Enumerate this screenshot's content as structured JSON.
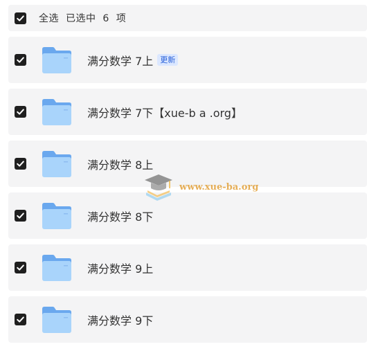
{
  "header": {
    "select_all_label": "全选",
    "selected_text": "已选中  6  项"
  },
  "icons": {
    "checkbox": "checkbox-checked-icon",
    "folder": "folder-icon",
    "watermark": "graduation-cap-book-icon"
  },
  "colors": {
    "row_background": "#f4f4f5",
    "checkbox": "#1f1f1f",
    "folder_light": "#a9d4fb",
    "folder_dark": "#6aa8ee",
    "badge_text": "#2b62d9",
    "badge_background": "#dbe7ff",
    "watermark": "#e2a13a"
  },
  "files": [
    {
      "name": "满分数学 7上",
      "badge": "更新",
      "checked": true
    },
    {
      "name": "满分数学 7下【xue-b a .org】",
      "checked": true
    },
    {
      "name": "满分数学 8上",
      "checked": true
    },
    {
      "name": "满分数学 8下",
      "checked": true
    },
    {
      "name": "满分数学 9上",
      "checked": true
    },
    {
      "name": "满分数学 9下",
      "checked": true
    }
  ],
  "watermark": {
    "text": "www.xue-ba.org"
  }
}
